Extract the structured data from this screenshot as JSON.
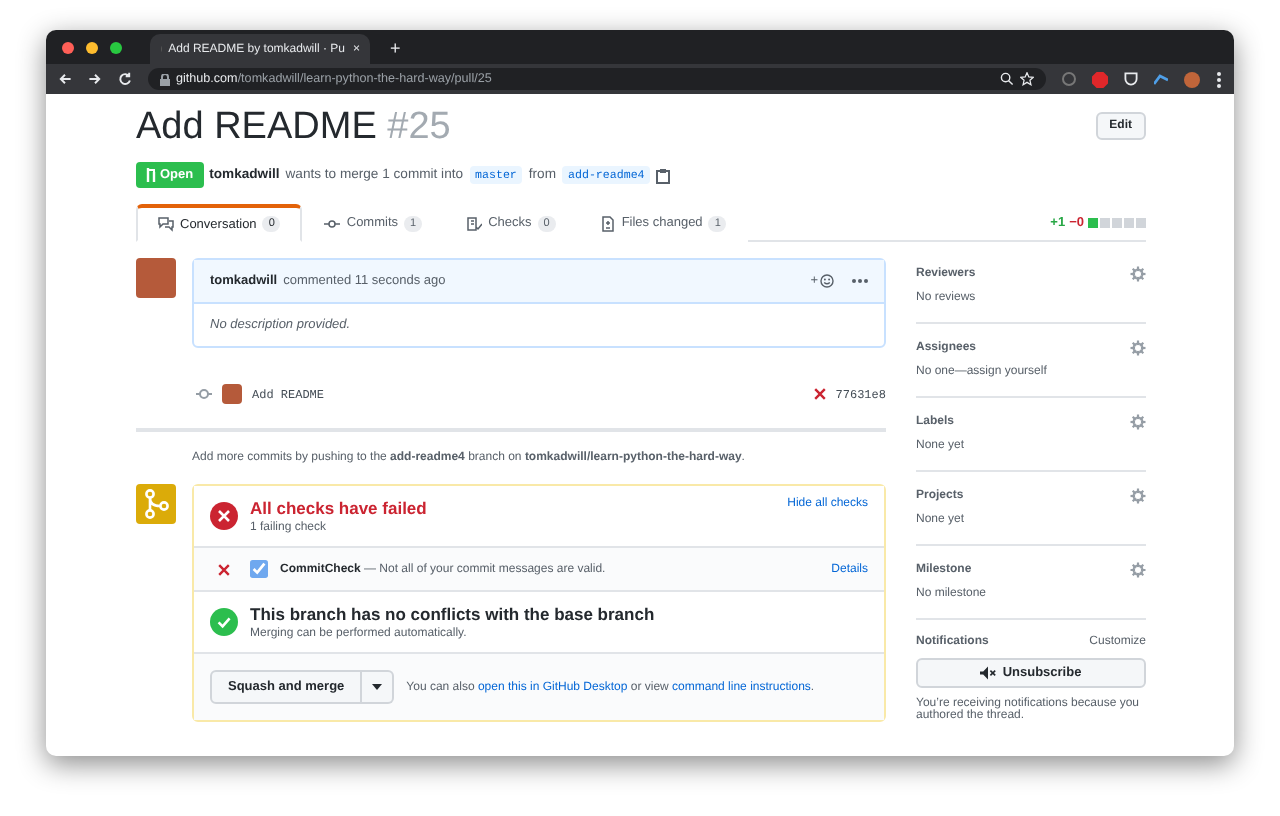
{
  "browser": {
    "tab_title": "Add README by tomkadwill · Pu",
    "tab_close": "×",
    "new_tab": "+",
    "url_domain": "github.com",
    "url_path": "/tomkadwill/learn-python-the-hard-way/pull/25"
  },
  "pr": {
    "title": "Add README",
    "number": "#25",
    "edit": "Edit",
    "open": true,
    "state_label": "Open",
    "author": "tomkadwill",
    "summary": "wants to merge 1 commit into",
    "base": "master",
    "from": "from",
    "head": "add-readme4"
  },
  "tabs": [
    {
      "label": "Conversation",
      "count": "0",
      "selected": true,
      "kind": "conversation"
    },
    {
      "label": "Commits",
      "count": "1",
      "selected": false,
      "kind": "commits"
    },
    {
      "label": "Checks",
      "count": "0",
      "selected": false,
      "kind": "checks"
    },
    {
      "label": "Files changed",
      "count": "1",
      "selected": false,
      "kind": "files"
    }
  ],
  "diffstat": {
    "added": "+1",
    "removed": "−0"
  },
  "comment": {
    "author": "tomkadwill",
    "meta": "commented 11 seconds ago",
    "reaction": "+",
    "body": "No description provided."
  },
  "commit": {
    "message": "Add README",
    "failed": true,
    "sha": "77631e8"
  },
  "push_hint": "Add more commits by pushing to the **add-readme4** branch on **tomkadwill/learn-python-the-hard-way**.",
  "merge": {
    "checks_title": "All checks have failed",
    "checks_sub": "1 failing check",
    "hide_link": "Hide all checks",
    "check": {
      "failed": true,
      "name": "CommitCheck",
      "description": "— Not all of your commit messages are valid.",
      "details": "Details"
    },
    "conflicts_title": "This branch has no conflicts with the base branch",
    "conflicts_sub": "Merging can be performed automatically.",
    "merge_button": "Squash and merge",
    "hint_before": "You can also",
    "hint_link1": "open this in GitHub Desktop",
    "hint_middle": "or view",
    "hint_link2": "command line instructions",
    "hint_end": "."
  },
  "sidebar": [
    {
      "title": "Reviewers",
      "value": "No reviews"
    },
    {
      "title": "Assignees",
      "value": "No one—assign yourself"
    },
    {
      "title": "Labels",
      "value": "None yet"
    },
    {
      "title": "Projects",
      "value": "None yet"
    },
    {
      "title": "Milestone",
      "value": "No milestone"
    }
  ],
  "notifications": {
    "title": "Notifications",
    "customize": "Customize",
    "button": "Unsubscribe",
    "note": "You’re receiving notifications because you authored the thread."
  }
}
